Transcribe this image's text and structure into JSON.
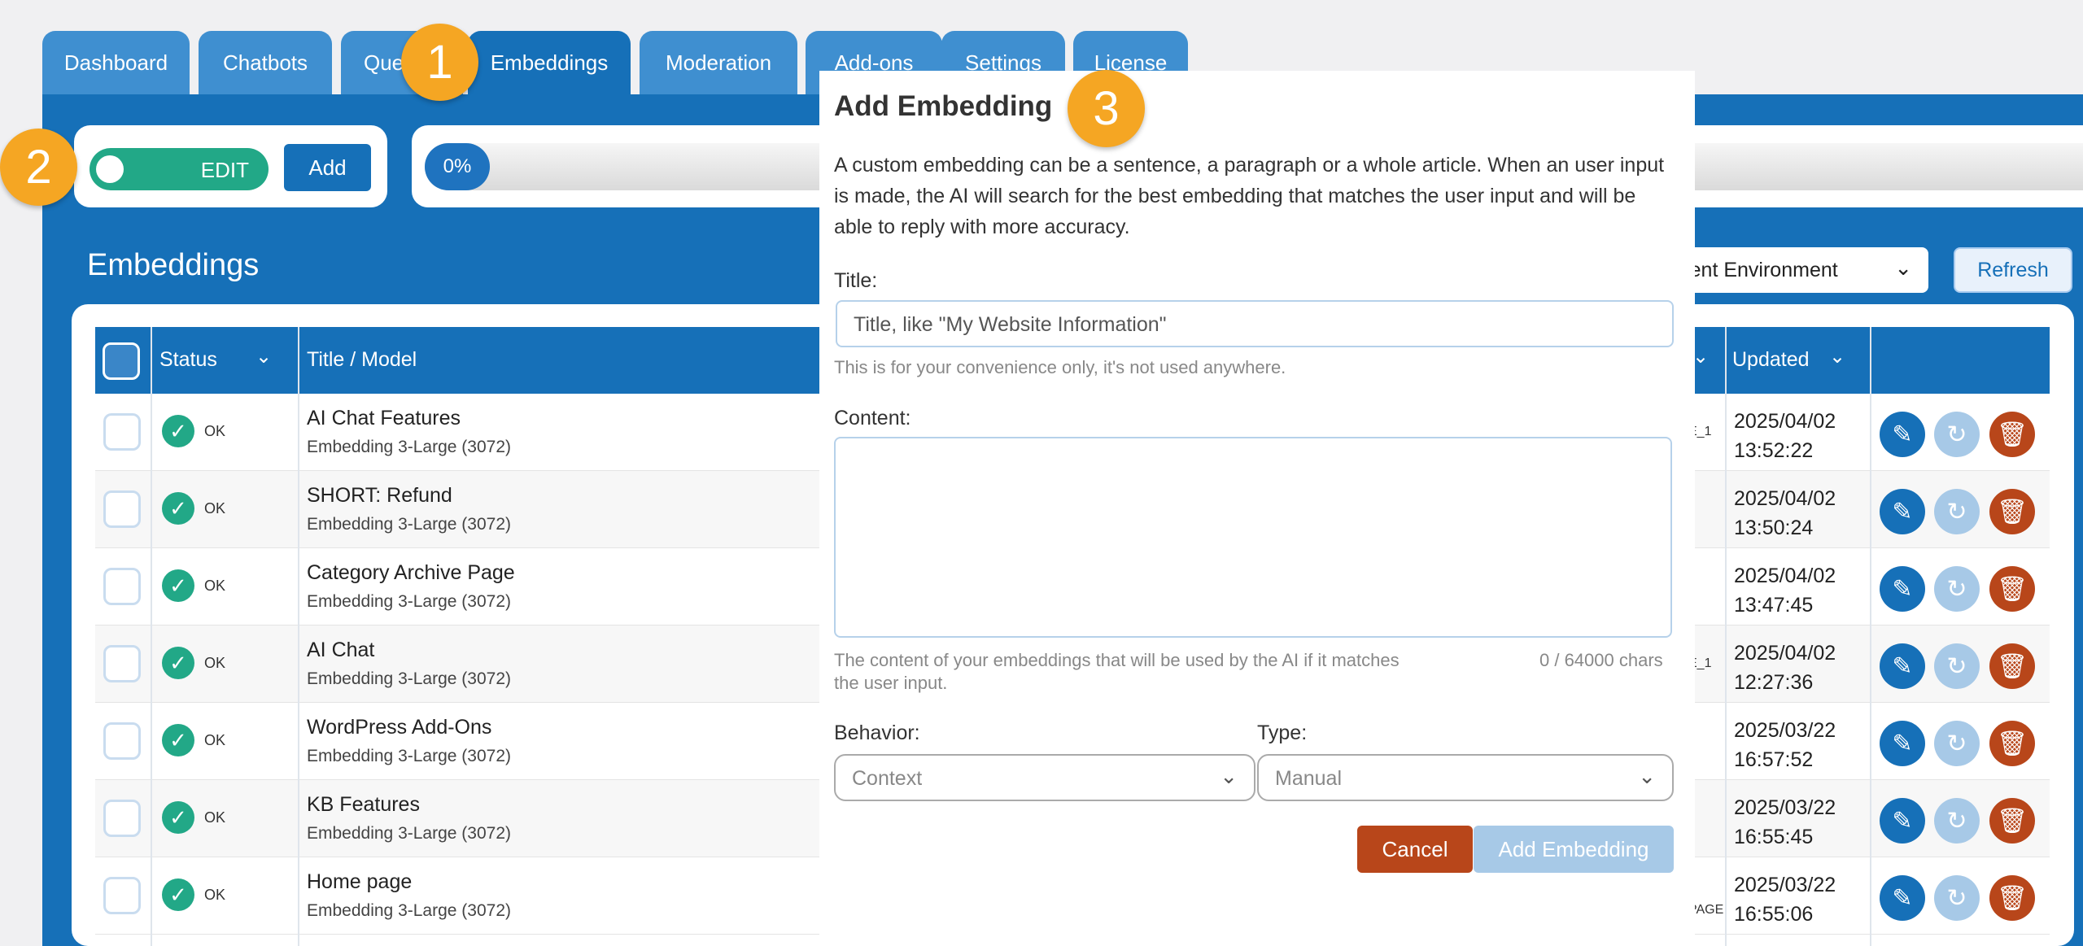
{
  "tabs": [
    {
      "label": "Dashboard"
    },
    {
      "label": "Chatbots"
    },
    {
      "label": "Que"
    },
    {
      "label": "Embeddings"
    },
    {
      "label": "Moderation"
    },
    {
      "label": "Add-ons"
    },
    {
      "label": "Settings"
    },
    {
      "label": "License"
    }
  ],
  "toolbar": {
    "toggle_label": "EDIT",
    "add_label": "Add",
    "progress_text": "0%",
    "progress_value": 0
  },
  "section": {
    "title": "Embeddings",
    "environment_select": "rrent Environment",
    "refresh_label": "Refresh"
  },
  "table": {
    "headers": {
      "status": "Status",
      "title": "Title / Model",
      "updated": "Updated"
    },
    "rows": [
      {
        "status": "OK",
        "title": "AI Chat Features",
        "model": "Embedding 3-Large (3072)",
        "date": "2025/04/02",
        "time": "13:52:22",
        "fragment": "E_1"
      },
      {
        "status": "OK",
        "title": "SHORT: Refund",
        "model": "Embedding 3-Large (3072)",
        "date": "2025/04/02",
        "time": "13:50:24",
        "fragment": ""
      },
      {
        "status": "OK",
        "title": "Category Archive Page",
        "model": "Embedding 3-Large (3072)",
        "date": "2025/04/02",
        "time": "13:47:45",
        "fragment": ""
      },
      {
        "status": "OK",
        "title": "AI Chat",
        "model": "Embedding 3-Large (3072)",
        "date": "2025/04/02",
        "time": "12:27:36",
        "fragment": "E_1"
      },
      {
        "status": "OK",
        "title": "WordPress Add-Ons",
        "model": "Embedding 3-Large (3072)",
        "date": "2025/03/22",
        "time": "16:57:52",
        "fragment": ""
      },
      {
        "status": "OK",
        "title": "KB Features",
        "model": "Embedding 3-Large (3072)",
        "date": "2025/03/22",
        "time": "16:55:45",
        "fragment": ""
      },
      {
        "status": "OK",
        "title": "Home page",
        "model": "Embedding 3-Large (3072)",
        "date": "2025/03/22",
        "time": "16:55:06",
        "fragment": "PAGE"
      }
    ]
  },
  "modal": {
    "title": "Add Embedding",
    "description": "A custom embedding can be a sentence, a paragraph or a whole article. When an user input is made, the AI will search for the best embedding that matches the user input and will be able to reply with more accuracy.",
    "title_label": "Title:",
    "title_placeholder": "Title, like \"My Website Information\"",
    "title_help": "This is for your convenience only, it's not used anywhere.",
    "content_label": "Content:",
    "content_value": "",
    "content_help": "The content of your embeddings that will be used by the AI if it matches the user input.",
    "char_count": "0 / 64000 chars",
    "behavior_label": "Behavior:",
    "behavior_value": "Context",
    "type_label": "Type:",
    "type_value": "Manual",
    "cancel_label": "Cancel",
    "submit_label": "Add Embedding"
  },
  "callouts": [
    "1",
    "2",
    "3"
  ],
  "colors": {
    "primary": "#1670b8",
    "tab": "#3f8fd0",
    "success": "#22a887",
    "danger": "#b8461a",
    "callout": "#f5a623",
    "disabled": "#a7c9e7"
  }
}
